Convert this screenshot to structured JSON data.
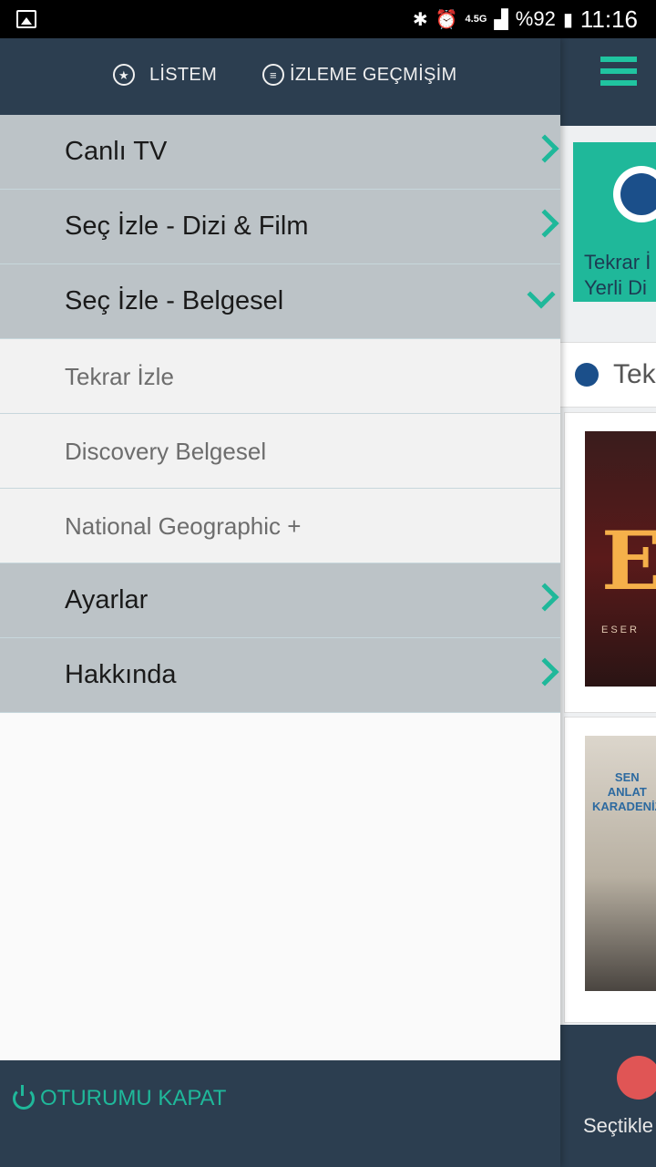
{
  "status_bar": {
    "battery": "%92",
    "network": "4.5G",
    "time": "11:16"
  },
  "drawer": {
    "header": {
      "listem_label": "LİSTEM",
      "history_label": "İZLEME GEÇMİŞİM"
    },
    "menu": [
      {
        "label": "Canlı TV",
        "type": "main",
        "expanded": false
      },
      {
        "label": "Seç İzle - Dizi & Film",
        "type": "main",
        "expanded": false
      },
      {
        "label": "Seç İzle - Belgesel",
        "type": "main",
        "expanded": true
      },
      {
        "label": "Tekrar İzle",
        "type": "sub"
      },
      {
        "label": "Discovery Belgesel",
        "type": "sub"
      },
      {
        "label": "National Geographic +",
        "type": "sub"
      },
      {
        "label": "Ayarlar",
        "type": "main",
        "expanded": false
      },
      {
        "label": "Hakkında",
        "type": "main",
        "expanded": false
      }
    ],
    "footer": {
      "logout_label": "OTURUMU KAPAT"
    }
  },
  "background_app": {
    "card_text_line1": "Tekrar İ",
    "card_text_line2": "Yerli Di",
    "tab_text": "Tek",
    "poster1_letter": "E",
    "poster1_sub": "ESER",
    "poster2_title_1": "SEN",
    "poster2_title_2": "ANLAT",
    "poster2_title_3": "KARADENİZ",
    "bottom_label": "Seçtikle"
  },
  "colors": {
    "header_bg": "#2c3e50",
    "accent": "#1fb89a",
    "main_item_bg": "#bcc3c7",
    "sub_item_bg": "#f2f2f2"
  }
}
